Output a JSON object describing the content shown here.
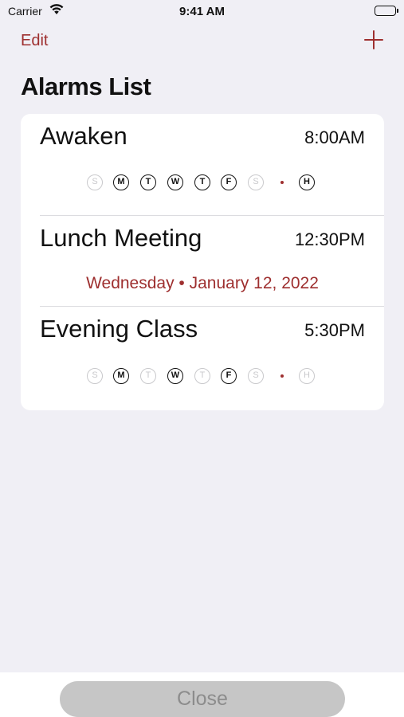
{
  "status_bar": {
    "carrier": "Carrier",
    "time": "9:41 AM"
  },
  "nav": {
    "edit_label": "Edit",
    "add_icon": "plus-icon"
  },
  "title": "Alarms List",
  "colors": {
    "accent": "#9e2f2f",
    "background": "#f0eff5",
    "inactive": "#c9c9cc"
  },
  "alarms": [
    {
      "name": "Awaken",
      "time": "8:00AM",
      "days": [
        {
          "letter": "S",
          "active": false
        },
        {
          "letter": "M",
          "active": true
        },
        {
          "letter": "T",
          "active": true
        },
        {
          "letter": "W",
          "active": true
        },
        {
          "letter": "T",
          "active": true
        },
        {
          "letter": "F",
          "active": true
        },
        {
          "letter": "S",
          "active": false
        }
      ],
      "holiday": {
        "letter": "H",
        "active": true
      }
    },
    {
      "name": "Lunch Meeting",
      "time": "12:30PM",
      "date": "Wednesday • January 12, 2022"
    },
    {
      "name": "Evening Class",
      "time": "5:30PM",
      "days": [
        {
          "letter": "S",
          "active": false
        },
        {
          "letter": "M",
          "active": true
        },
        {
          "letter": "T",
          "active": false
        },
        {
          "letter": "W",
          "active": true
        },
        {
          "letter": "T",
          "active": false
        },
        {
          "letter": "F",
          "active": true
        },
        {
          "letter": "S",
          "active": false
        }
      ],
      "holiday": {
        "letter": "H",
        "active": false
      }
    }
  ],
  "close_label": "Close"
}
